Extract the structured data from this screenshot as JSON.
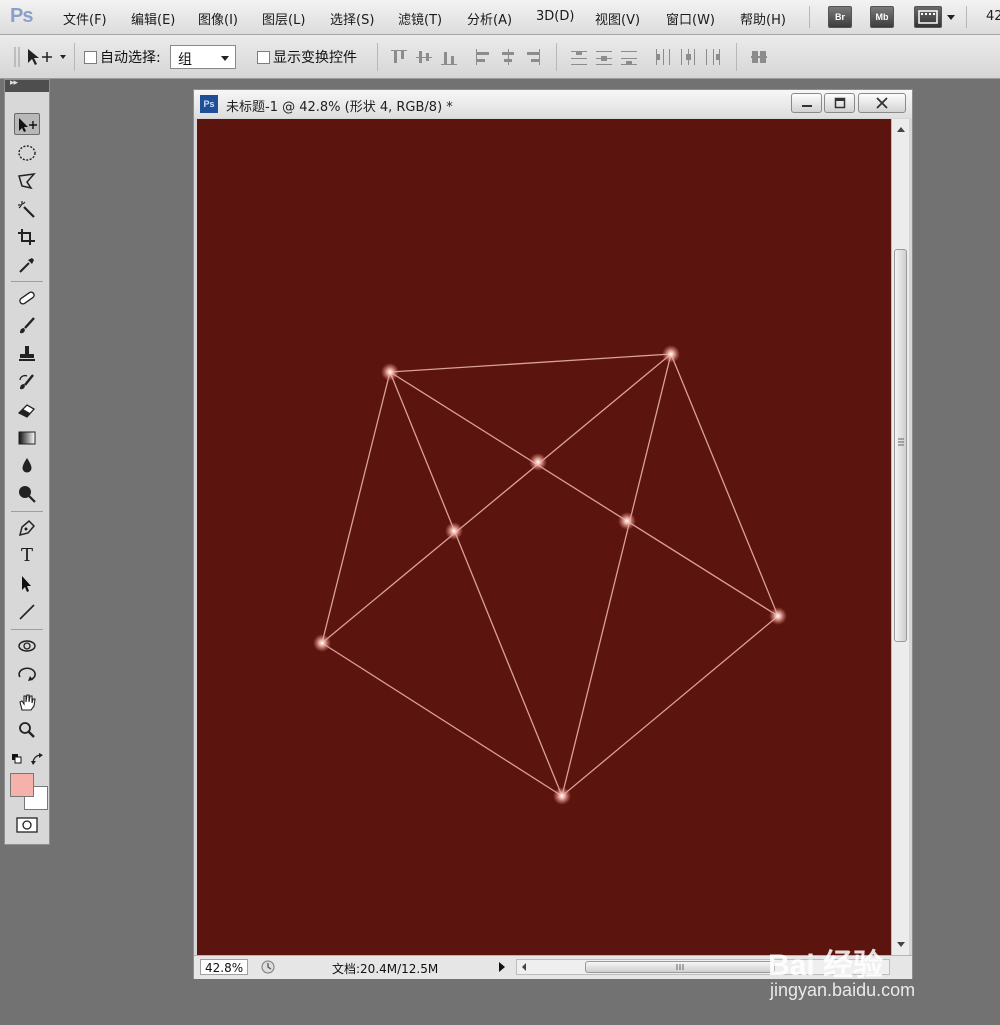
{
  "app": {
    "logo": "Ps"
  },
  "menu": {
    "items": [
      "文件(F)",
      "编辑(E)",
      "图像(I)",
      "图层(L)",
      "选择(S)",
      "滤镜(T)",
      "分析(A)",
      "3D(D)",
      "视图(V)",
      "窗口(W)",
      "帮助(H)"
    ],
    "bridge_label": "Br",
    "minibridge_label": "Mb",
    "zoom_readout": "42"
  },
  "options_bar": {
    "auto_select_label": "自动选择:",
    "auto_select_value": "组",
    "show_transform_label": "显示变换控件"
  },
  "tools": [
    {
      "name": "move-tool",
      "icon": "move-arrow-icon",
      "active": true
    },
    {
      "name": "elliptical-marquee-tool",
      "icon": "ellipse-marquee-icon"
    },
    {
      "name": "lasso-tool",
      "icon": "polygon-lasso-icon"
    },
    {
      "name": "magic-wand-tool",
      "icon": "magic-wand-icon"
    },
    {
      "name": "crop-tool",
      "icon": "crop-icon"
    },
    {
      "name": "eyedropper-tool",
      "icon": "eyedropper-icon"
    },
    {
      "name": "healing-brush-tool",
      "icon": "bandage-icon"
    },
    {
      "name": "brush-tool",
      "icon": "brush-icon"
    },
    {
      "name": "clone-stamp-tool",
      "icon": "stamp-icon"
    },
    {
      "name": "history-brush-tool",
      "icon": "history-brush-icon"
    },
    {
      "name": "eraser-tool",
      "icon": "eraser-icon"
    },
    {
      "name": "gradient-tool",
      "icon": "gradient-icon"
    },
    {
      "name": "blur-tool",
      "icon": "drop-icon"
    },
    {
      "name": "dodge-tool",
      "icon": "dodge-icon"
    },
    {
      "name": "pen-tool",
      "icon": "pen-icon"
    },
    {
      "name": "type-tool",
      "icon": "type-icon",
      "glyph": "T"
    },
    {
      "name": "path-selection-tool",
      "icon": "arrow-pointer-icon"
    },
    {
      "name": "line-tool",
      "icon": "line-icon"
    },
    {
      "name": "3d-rotate-tool",
      "icon": "3d-rotate-icon"
    },
    {
      "name": "3d-orbit-tool",
      "icon": "3d-orbit-icon"
    },
    {
      "name": "hand-tool",
      "icon": "hand-icon"
    },
    {
      "name": "zoom-tool",
      "icon": "magnifier-icon"
    }
  ],
  "colors": {
    "foreground": "#f5b2aa",
    "background": "#ffffff",
    "canvas": "#5b140e",
    "line": "#e8b0a8"
  },
  "document": {
    "title": "未标题-1 @ 42.8% (形状 4, RGB/8) *",
    "zoom": "42.8%",
    "doc_info": "文档:20.4M/12.5M"
  },
  "watermark": {
    "brand": "Bai 经验",
    "url": "jingyan.baidu.com"
  }
}
